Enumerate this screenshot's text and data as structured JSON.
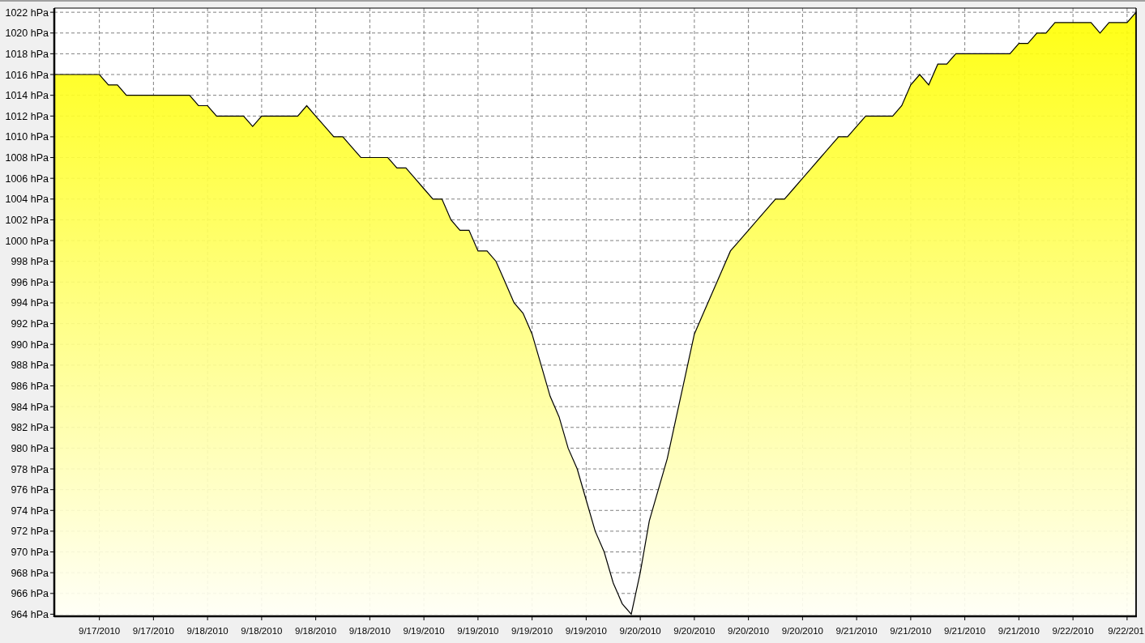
{
  "chart_data": {
    "type": "area",
    "grid": true,
    "ylim": [
      963.8,
      1022.4
    ],
    "yticks": [
      {
        "value": 964,
        "label": "964 hPa"
      },
      {
        "value": 966,
        "label": "966 hPa"
      },
      {
        "value": 968,
        "label": "968 hPa"
      },
      {
        "value": 970,
        "label": "970 hPa"
      },
      {
        "value": 972,
        "label": "972 hPa"
      },
      {
        "value": 974,
        "label": "974 hPa"
      },
      {
        "value": 976,
        "label": "976 hPa"
      },
      {
        "value": 978,
        "label": "978 hPa"
      },
      {
        "value": 980,
        "label": "980 hPa"
      },
      {
        "value": 982,
        "label": "982 hPa"
      },
      {
        "value": 984,
        "label": "984 hPa"
      },
      {
        "value": 986,
        "label": "986 hPa"
      },
      {
        "value": 988,
        "label": "988 hPa"
      },
      {
        "value": 990,
        "label": "990 hPa"
      },
      {
        "value": 992,
        "label": "992 hPa"
      },
      {
        "value": 994,
        "label": "994 hPa"
      },
      {
        "value": 996,
        "label": "996 hPa"
      },
      {
        "value": 998,
        "label": "998 hPa"
      },
      {
        "value": 1000,
        "label": "1000 hPa"
      },
      {
        "value": 1002,
        "label": "1002 hPa"
      },
      {
        "value": 1004,
        "label": "1004 hPa"
      },
      {
        "value": 1006,
        "label": "1006 hPa"
      },
      {
        "value": 1008,
        "label": "1008 hPa"
      },
      {
        "value": 1010,
        "label": "1010 hPa"
      },
      {
        "value": 1012,
        "label": "1012 hPa"
      },
      {
        "value": 1014,
        "label": "1014 hPa"
      },
      {
        "value": 1016,
        "label": "1016 hPa"
      },
      {
        "value": 1018,
        "label": "1018 hPa"
      },
      {
        "value": 1020,
        "label": "1020 hPa"
      },
      {
        "value": 1022,
        "label": "1022 hPa"
      }
    ],
    "categories": [
      null,
      null,
      null,
      null,
      null,
      "9/17/2010",
      null,
      null,
      null,
      null,
      null,
      "9/17/2010",
      null,
      null,
      null,
      null,
      null,
      "9/18/2010",
      null,
      null,
      null,
      null,
      null,
      "9/18/2010",
      null,
      null,
      null,
      null,
      null,
      "9/18/2010",
      null,
      null,
      null,
      null,
      null,
      "9/18/2010",
      null,
      null,
      null,
      null,
      null,
      "9/19/2010",
      null,
      null,
      null,
      null,
      null,
      "9/19/2010",
      null,
      null,
      null,
      null,
      null,
      "9/19/2010",
      null,
      null,
      null,
      null,
      null,
      "9/19/2010",
      null,
      null,
      null,
      null,
      null,
      "9/20/2010",
      null,
      null,
      null,
      null,
      null,
      "9/20/2010",
      null,
      null,
      null,
      null,
      null,
      "9/20/2010",
      null,
      null,
      null,
      null,
      null,
      "9/20/2010",
      null,
      null,
      null,
      null,
      null,
      "9/21/2010",
      null,
      null,
      null,
      null,
      null,
      "9/21/2010",
      null,
      null,
      null,
      null,
      null,
      "9/21/2010",
      null,
      null,
      null,
      null,
      null,
      "9/21/2010",
      null,
      null,
      null,
      null,
      null,
      "9/22/2010",
      null,
      null,
      null,
      null,
      null,
      "9/22/201",
      null
    ],
    "series": [
      {
        "color": "#000000",
        "values": [
          1016,
          1016,
          1016,
          1016,
          1016,
          1016,
          1015,
          1015,
          1014,
          1014,
          1014,
          1014,
          1014,
          1014,
          1014,
          1014,
          1013,
          1013,
          1012,
          1012,
          1012,
          1012,
          1011,
          1012,
          1012,
          1012,
          1012,
          1012,
          1013,
          1012,
          1011,
          1010,
          1010,
          1009,
          1008,
          1008,
          1008,
          1008,
          1007,
          1007,
          1006,
          1005,
          1004,
          1004,
          1002,
          1001,
          1001,
          999,
          999,
          998,
          996,
          994,
          993,
          991,
          988,
          985,
          983,
          980,
          978,
          975,
          972,
          970,
          967,
          965,
          964,
          968,
          973,
          976,
          979,
          983,
          987,
          991,
          993,
          995,
          997,
          999,
          1000,
          1001,
          1002,
          1003,
          1004,
          1004,
          1005,
          1006,
          1007,
          1008,
          1009,
          1010,
          1010,
          1011,
          1012,
          1012,
          1012,
          1012,
          1013,
          1015,
          1016,
          1015,
          1017,
          1017,
          1018,
          1018,
          1018,
          1018,
          1018,
          1018,
          1018,
          1019,
          1019,
          1020,
          1020,
          1021,
          1021,
          1021,
          1021,
          1021,
          1020,
          1021,
          1021,
          1021,
          1022
        ]
      }
    ]
  }
}
